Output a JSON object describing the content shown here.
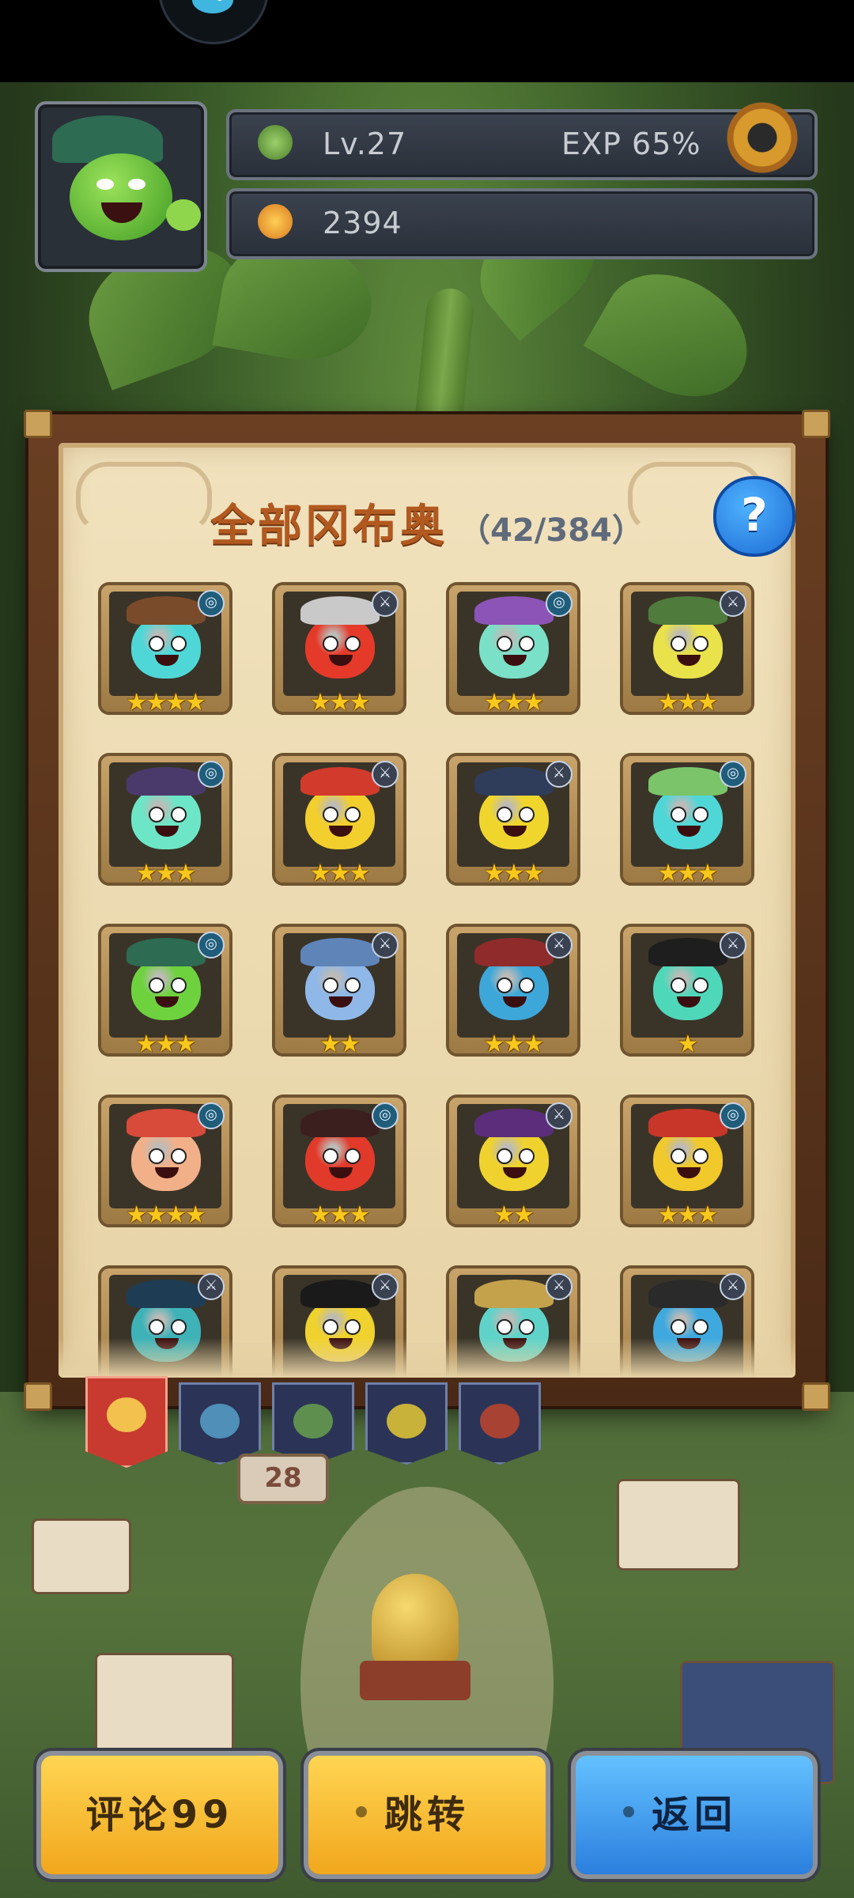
{
  "header": {
    "level": "Lv.27",
    "exp": "EXP 65%",
    "currency": "2394"
  },
  "panel": {
    "title": "全部冈布奥",
    "count": "（42/384）",
    "help_label": "?"
  },
  "cards": [
    {
      "stars": "★★★★",
      "color": "#4fd7d7",
      "badge": "spiral"
    },
    {
      "stars": "★★★",
      "color": "#e53a2a",
      "badge": "sword"
    },
    {
      "stars": "★★★",
      "color": "#7ae0c8",
      "badge": "spiral"
    },
    {
      "stars": "★★★",
      "color": "#e9e24a",
      "badge": "sword"
    },
    {
      "stars": "★★★",
      "color": "#6ce6c6",
      "badge": "spiral"
    },
    {
      "stars": "★★★",
      "color": "#f3cf2d",
      "badge": "sword"
    },
    {
      "stars": "★★★",
      "color": "#f0d62c",
      "badge": "sword"
    },
    {
      "stars": "★★★",
      "color": "#4fd7d7",
      "badge": "spiral"
    },
    {
      "stars": "★★★",
      "color": "#6ed23f",
      "badge": "spiral"
    },
    {
      "stars": "★★",
      "color": "#8fb8e8",
      "badge": "sword"
    },
    {
      "stars": "★★★",
      "color": "#3ea7d9",
      "badge": "sword"
    },
    {
      "stars": "★",
      "color": "#4fd7b9",
      "badge": "sword"
    },
    {
      "stars": "★★★★",
      "color": "#f2b089",
      "badge": "spiral"
    },
    {
      "stars": "★★★",
      "color": "#e23a2a",
      "badge": "spiral"
    },
    {
      "stars": "★★",
      "color": "#f0d22e",
      "badge": "sword"
    },
    {
      "stars": "★★★",
      "color": "#f2c92a",
      "badge": "spiral"
    },
    {
      "stars": "",
      "color": "#3fb2b8",
      "badge": "sword"
    },
    {
      "stars": "",
      "color": "#f0d22e",
      "badge": "sword"
    },
    {
      "stars": "",
      "color": "#5fd3c9",
      "badge": "sword"
    },
    {
      "stars": "",
      "color": "#3fa9df",
      "badge": "sword"
    }
  ],
  "tabs": [
    {
      "name": "all",
      "color": "#c83a2f"
    },
    {
      "name": "blue",
      "color": "#2b3456"
    },
    {
      "name": "green",
      "color": "#2b3456"
    },
    {
      "name": "yellow",
      "color": "#2b3456"
    },
    {
      "name": "red",
      "color": "#2b3456"
    }
  ],
  "sign_text": "28",
  "buttons": {
    "comment": "评论99",
    "jump": "跳转",
    "back": "返回"
  },
  "colors": {
    "gold_button": "#f1a71d",
    "blue_button": "#2b7fde",
    "title": "#b2591f"
  },
  "icons": {
    "gear": "gear-icon",
    "help": "help-icon",
    "level": "leaf-level-icon",
    "currency": "fruit-currency-icon"
  }
}
